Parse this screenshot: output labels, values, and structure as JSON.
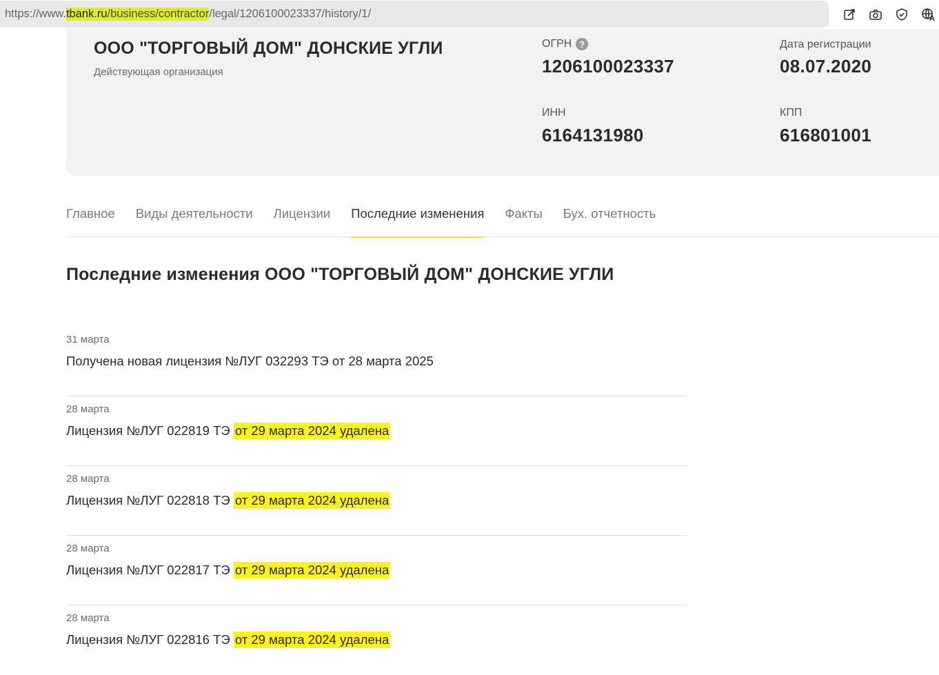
{
  "browser": {
    "url_prefix": "https://www.",
    "url_domain": "tbank.ru",
    "url_path_highlight": "/business/contractor",
    "url_path_rest": "/legal/1206100023337/history/1/"
  },
  "company": {
    "name": "ООО \"ТОРГОВЫЙ ДОМ\" ДОНСКИЕ УГЛИ",
    "status": "Действующая организация",
    "ogrn_label": "ОГРН",
    "ogrn_value": "1206100023337",
    "reg_date_label": "Дата регистрации",
    "reg_date_value": "08.07.2020",
    "inn_label": "ИНН",
    "inn_value": "6164131980",
    "kpp_label": "КПП",
    "kpp_value": "616801001",
    "help_glyph": "?"
  },
  "tabs": [
    {
      "label": "Главное"
    },
    {
      "label": "Виды деятельности"
    },
    {
      "label": "Лицензии"
    },
    {
      "label": "Последние изменения"
    },
    {
      "label": "Факты"
    },
    {
      "label": "Бух. отчетность"
    }
  ],
  "section_title": "Последние изменения ООО \"ТОРГОВЫЙ ДОМ\" ДОНСКИЕ УГЛИ",
  "changes": [
    {
      "date": "31 марта",
      "text": "Получена новая лицензия №ЛУГ 032293 ТЭ от 28 марта 2025",
      "highlight": ""
    },
    {
      "date": "28 марта",
      "text": "Лицензия №ЛУГ 022819 ТЭ ",
      "highlight": "от 29 марта 2024 удалена"
    },
    {
      "date": "28 марта",
      "text": "Лицензия №ЛУГ 022818 ТЭ ",
      "highlight": "от 29 марта 2024 удалена"
    },
    {
      "date": "28 марта",
      "text": "Лицензия №ЛУГ 022817 ТЭ ",
      "highlight": "от 29 марта 2024 удалена"
    },
    {
      "date": "28 марта",
      "text": "Лицензия №ЛУГ 022816 ТЭ ",
      "highlight": "от 29 марта 2024 удалена"
    }
  ],
  "colors": {
    "accent_tab": "#ffdd2d",
    "text_highlight": "#fff21a",
    "url_highlight": "#e2ed1c"
  },
  "icons": [
    "edit-page-icon",
    "camera-icon",
    "shield-icon",
    "translate-icon"
  ]
}
